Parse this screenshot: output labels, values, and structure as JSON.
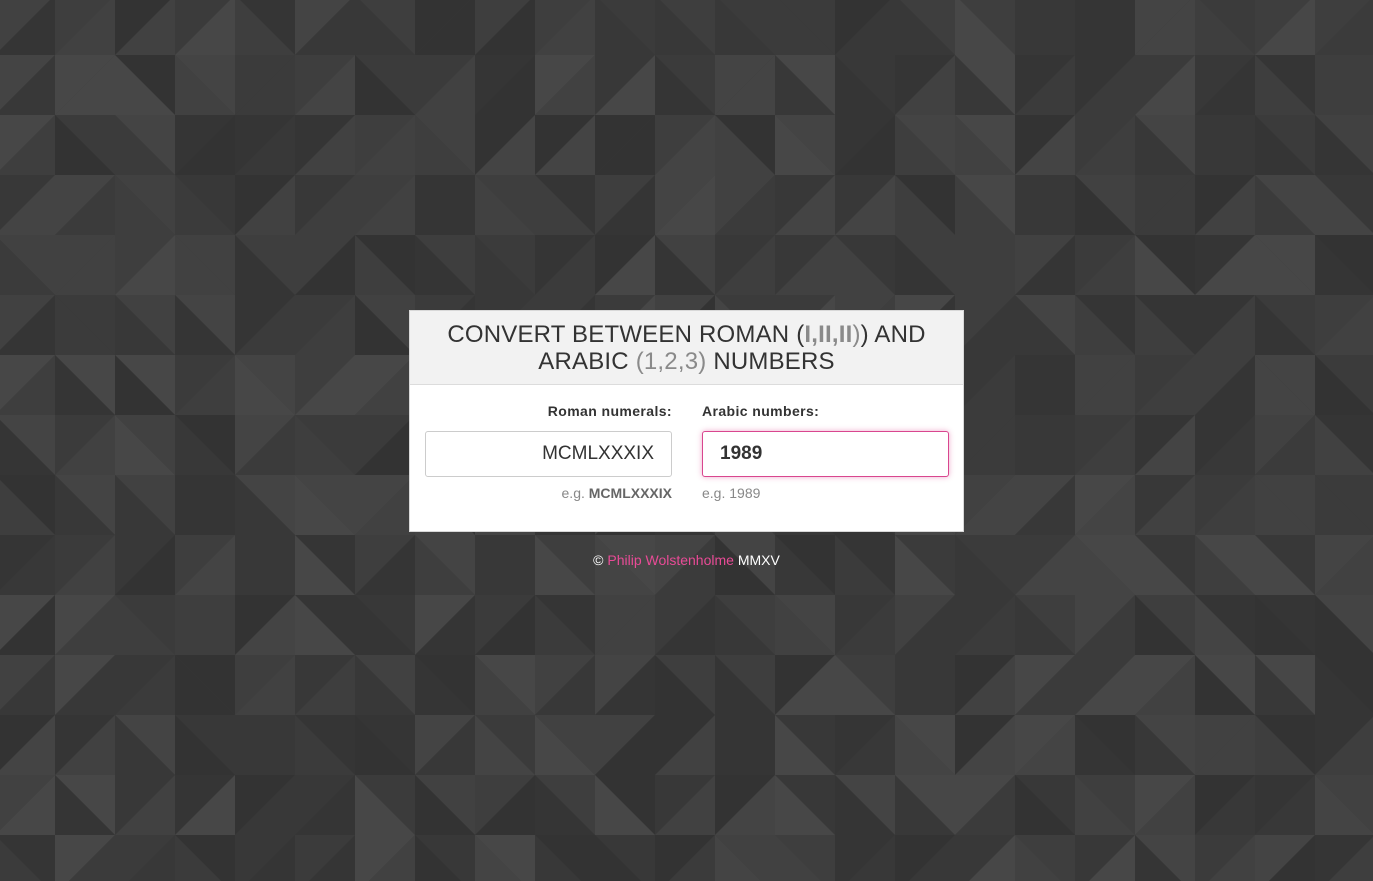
{
  "header": {
    "title_part1": "CONVERT BETWEEN ROMAN (",
    "title_roman": "I,II,II",
    "title_part2": ") AND",
    "title_part3": "ARABIC ",
    "title_arabic": "(1,2,3)",
    "title_part4": " NUMBERS"
  },
  "roman": {
    "label": "Roman numerals:",
    "value": "MCMLXXXIX",
    "hint_prefix": "e.g. ",
    "hint_example": "MCMLXXXIX"
  },
  "arabic": {
    "label": "Arabic numbers:",
    "value": "1989",
    "hint": "e.g. 1989"
  },
  "footer": {
    "copyright": "©",
    "author": "Philip Wolstenholme",
    "year": "MMXV"
  },
  "colors": {
    "accent": "#e84b96",
    "background": "#3a3a3a"
  }
}
